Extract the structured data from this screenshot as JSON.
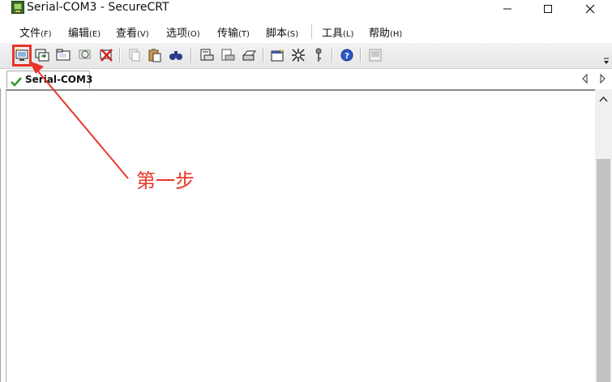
{
  "window": {
    "title": "Serial-COM3 - SecureCRT"
  },
  "menu": [
    {
      "label": "文件",
      "hotkey": "(F)"
    },
    {
      "label": "编辑",
      "hotkey": "(E)"
    },
    {
      "label": "查看",
      "hotkey": "(V)"
    },
    {
      "label": "选项",
      "hotkey": "(O)"
    },
    {
      "label": "传输",
      "hotkey": "(T)"
    },
    {
      "label": "脚本",
      "hotkey": "(S)"
    },
    {
      "label": "工具",
      "hotkey": "(L)"
    },
    {
      "label": "帮助",
      "hotkey": "(H)"
    }
  ],
  "toolbar_icons": [
    "quick-connect-icon",
    "connect-icon",
    "connect-in-tab-icon",
    "reconnect-icon",
    "disconnect-icon",
    "copy-icon",
    "paste-icon",
    "find-icon",
    "print-icon",
    "print-selection-icon",
    "print-setup-icon",
    "session-options-icon",
    "global-options-icon",
    "keymap-icon",
    "help-icon",
    "about-icon"
  ],
  "tab": {
    "label": "Serial-COM3"
  },
  "annotation": {
    "text": "第一步",
    "color": "#e8362a"
  }
}
